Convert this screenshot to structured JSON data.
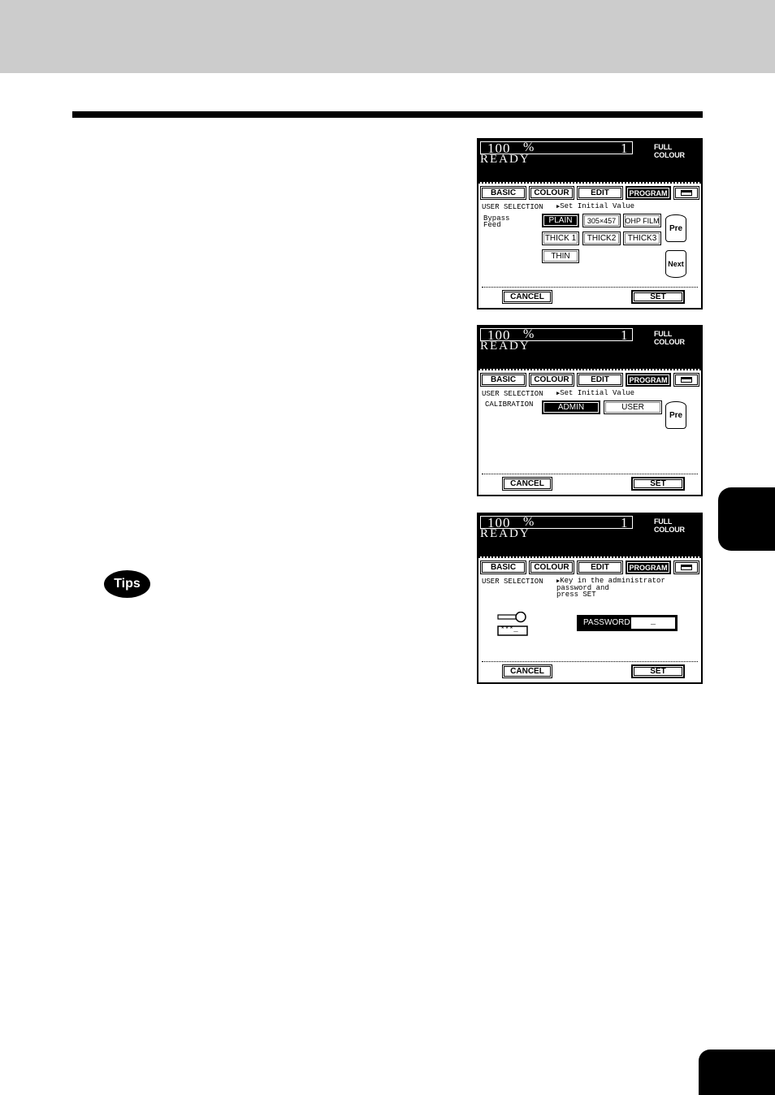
{
  "page": {
    "tips_label": "Tips"
  },
  "screens": [
    {
      "zoom": "100",
      "zoom_unit": "%",
      "copies": "1",
      "mode": "FULL COLOUR",
      "status": "READY",
      "tabs": [
        "BASIC",
        "COLOUR",
        "EDIT",
        "PROGRAM"
      ],
      "heading": "USER SELECTION",
      "hint": "Set Initial Value",
      "field_label": "Bypass\nFeed",
      "options": [
        {
          "label": "PLAIN",
          "selected": true
        },
        {
          "label": "305×457",
          "selected": false
        },
        {
          "label": "OHP FILM",
          "selected": false
        },
        {
          "label": "THICK 1",
          "selected": false
        },
        {
          "label": "THICK2",
          "selected": false
        },
        {
          "label": "THICK3",
          "selected": false
        },
        {
          "label": "THIN",
          "selected": false
        }
      ],
      "pre_label": "Pre",
      "next_label": "Next",
      "cancel_label": "CANCEL",
      "set_label": "SET"
    },
    {
      "zoom": "100",
      "zoom_unit": "%",
      "copies": "1",
      "mode": "FULL COLOUR",
      "status": "READY",
      "tabs": [
        "BASIC",
        "COLOUR",
        "EDIT",
        "PROGRAM"
      ],
      "heading": "USER SELECTION",
      "hint": "Set Initial Value",
      "field_label": "CALIBRATION",
      "options": [
        {
          "label": "ADMIN",
          "selected": true
        },
        {
          "label": "USER",
          "selected": false
        }
      ],
      "pre_label": "Pre",
      "cancel_label": "CANCEL",
      "set_label": "SET"
    },
    {
      "zoom": "100",
      "zoom_unit": "%",
      "copies": "1",
      "mode": "FULL COLOUR",
      "status": "READY",
      "tabs": [
        "BASIC",
        "COLOUR",
        "EDIT",
        "PROGRAM"
      ],
      "heading": "USER SELECTION",
      "hint": "Key in the administrator\npassword and\npress SET",
      "key_caption": "***_",
      "password_label": "PASSWORD",
      "password_value": "_",
      "cancel_label": "CANCEL",
      "set_label": "SET"
    }
  ]
}
